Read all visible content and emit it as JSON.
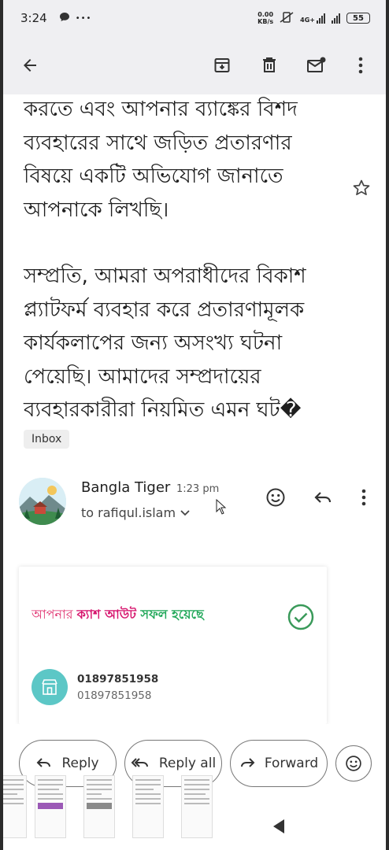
{
  "status": {
    "time": "3:24",
    "net_speed_value": "0.00",
    "net_speed_unit": "KB/s",
    "network_type": "4G+",
    "battery": "55",
    "more": "•••"
  },
  "app_bar": {
    "icons": [
      "back-arrow-icon",
      "archive-icon",
      "delete-icon",
      "mark-unread-icon",
      "more-vert-icon"
    ]
  },
  "email": {
    "paragraph_1": "করতে এবং আপনার ব্যাঙ্কের বিশদ ব্যবহারের সাথে জড়িত প্রতারণার বিষয়ে একটি অভিযোগ জানাতে আপনাকে লিখছি।",
    "paragraph_2": "সম্প্রতি, আমরা অপরাধীদের বিকাশ প্ল্যাটফর্ম ব্যবহার করে প্রতারণামূলক কার্যকলাপের জন্য অসংখ্য ঘটনা পেয়েছি। আমাদের সম্প্রদায়ের ব্যবহারকারীরা নিয়মিত এমন ঘট�",
    "label": "Inbox"
  },
  "sender": {
    "name": "Bangla Tiger",
    "time": "1:23 pm",
    "recipient": "to rafiqul.islam"
  },
  "card": {
    "title_part1": "আপনার ",
    "title_part2": "ক্যাশ আউট ",
    "title_part3": " সফল হয়েছে",
    "account_line1": "01897851958",
    "account_line2": "01897851958"
  },
  "actions": {
    "reply": "Reply",
    "reply_all": "Reply all",
    "forward": "Forward"
  },
  "colors": {
    "pink": "#d6146d",
    "green": "#22a85a",
    "teal": "#5cc7c6"
  }
}
